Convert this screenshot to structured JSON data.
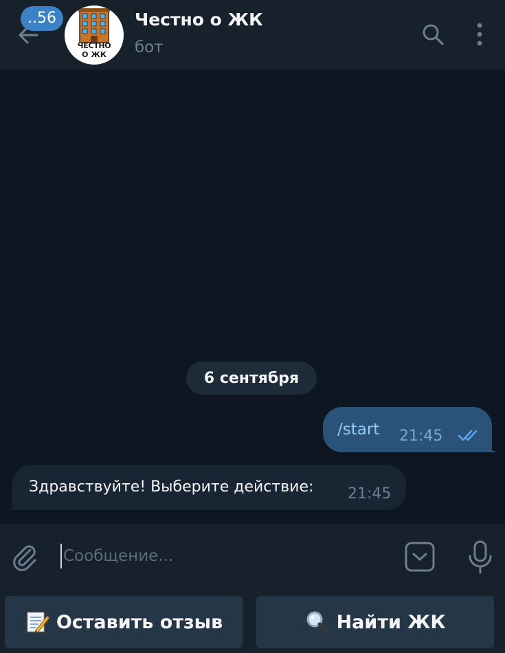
{
  "header": {
    "unread_count": "..56",
    "title": "Честно о ЖК",
    "subtitle": "бот",
    "avatar_text_line1": "ЧЕСТНО",
    "avatar_text_line2": "О ЖК"
  },
  "chat": {
    "date_label": "6 сентября",
    "messages": [
      {
        "direction": "outgoing",
        "text": "/start",
        "time": "21:45",
        "status": "read"
      },
      {
        "direction": "incoming",
        "text": "Здравствуйте! Выберите действие:",
        "time": "21:45"
      }
    ]
  },
  "composer": {
    "placeholder": "Сообщение..."
  },
  "bot_keyboard": {
    "buttons": [
      {
        "label": "Оставить отзыв",
        "icon": "memo-icon"
      },
      {
        "label": "Найти ЖК",
        "icon": "magnifier-icon"
      }
    ]
  },
  "colors": {
    "background": "#0e1621",
    "panel": "#17212b",
    "outgoing_bubble": "#2b5278",
    "incoming_bubble": "#182533",
    "accent": "#3b82c4",
    "keyboard_button": "#253647"
  }
}
